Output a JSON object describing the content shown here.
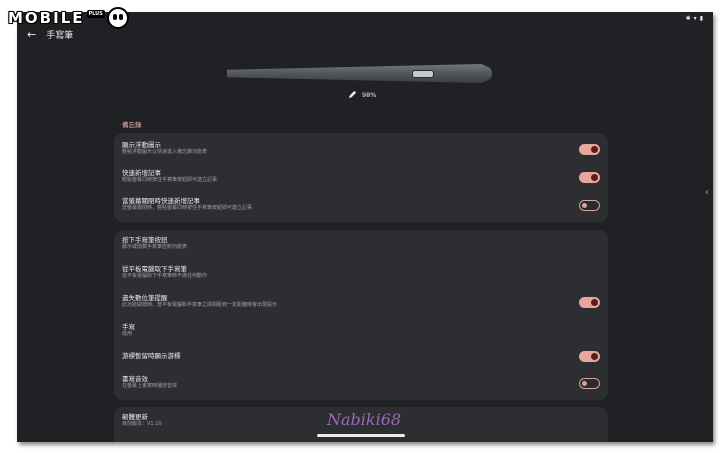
{
  "logo": {
    "text": "MOBILE",
    "badge": "PLUS"
  },
  "status_bar": {
    "icons": [
      "bluetooth-icon",
      "wifi-icon",
      "battery-icon"
    ]
  },
  "header": {
    "back_icon": "arrow-left-icon",
    "title": "手寫筆"
  },
  "pen": {
    "battery_icon": "pencil-icon",
    "battery_level": "98%"
  },
  "memo_section": {
    "header": "備忘錄"
  },
  "card1": {
    "rows": [
      {
        "title": "顯示浮動圖示",
        "subtitle": "輕點浮動圖示以快速進入備忘錄功能表",
        "toggle": "on"
      },
      {
        "title": "快速新增記事",
        "subtitle": "輕點螢幕同時按住手寫筆按鈕即可建立記事",
        "toggle": "on"
      },
      {
        "title": "當螢幕關閉時快速新增記事",
        "subtitle": "當螢幕關閉時，輕點螢幕同時按住手寫筆按鈕即可建立記事",
        "toggle": "off"
      }
    ]
  },
  "card2": {
    "rows": [
      {
        "title": "按下手寫筆按鈕",
        "subtitle": "顯示或隱藏手寫筆控制功能表",
        "toggle": null
      },
      {
        "title": "從平板電腦取下手寫筆",
        "subtitle": "從平板電腦取下手寫筆時不做任何動作",
        "toggle": null
      },
      {
        "title": "遺失數位筆提醒",
        "subtitle": "此功能開啟時，當平板電腦和手寫筆之間相距到一定距離時會出現提示",
        "toggle": "on"
      },
      {
        "title": "手寫",
        "subtitle": "啟用",
        "toggle": null
      },
      {
        "title": "游標暫留時顯示游標",
        "subtitle": "",
        "toggle": "on"
      },
      {
        "title": "書寫音效",
        "subtitle": "在螢幕上書寫時播放音效",
        "toggle": "off"
      }
    ]
  },
  "card3": {
    "title": "韌體更新",
    "subtitle": "目前版本：V1.10"
  },
  "watermark": "Nabiki68",
  "colors": {
    "accent": "#e8a79c",
    "knob_on": "#5c1b1b",
    "card": "#2d2e31",
    "background": "#202124",
    "section_header": "#f2b8b5"
  }
}
